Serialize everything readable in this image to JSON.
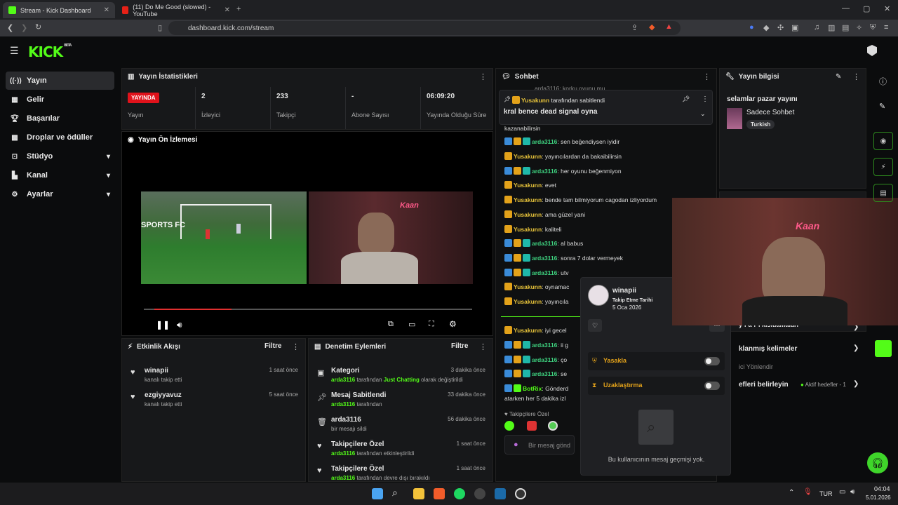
{
  "browser": {
    "tabs": [
      {
        "title": "Stream - Kick Dashboard"
      },
      {
        "title": "(11) Do Me Good (slowed) - YouTube"
      }
    ],
    "url": "dashboard.kick.com/stream"
  },
  "header": {
    "logo": "KICK",
    "beta": "BETA"
  },
  "sidebar": {
    "items": [
      {
        "label": "Yayın",
        "icon": "broadcast-icon"
      },
      {
        "label": "Gelir",
        "icon": "revenue-icon"
      },
      {
        "label": "Başarılar",
        "icon": "trophy-icon"
      },
      {
        "label": "Droplar ve ödüller",
        "icon": "gift-icon"
      },
      {
        "label": "Stüdyo",
        "icon": "studio-icon"
      },
      {
        "label": "Kanal",
        "icon": "channel-icon"
      },
      {
        "label": "Ayarlar",
        "icon": "gear-icon"
      }
    ]
  },
  "stats": {
    "title": "Yayın İstatistikleri",
    "live_badge": "YAYINDA",
    "live_label": "Yayın",
    "viewers_value": "2",
    "viewers_label": "İzleyici",
    "followers_value": "233",
    "followers_label": "Takipçi",
    "subs_value": "-",
    "subs_label": "Abone Sayısı",
    "uptime_value": "06:09:20",
    "uptime_label": "Yayında Olduğu Süre"
  },
  "preview": {
    "title": "Yayın Ön İzlemesi",
    "overlay_text": "SPORTS FC",
    "neon_text": "Kaan"
  },
  "activity": {
    "title": "Etkinlik Akışı",
    "filter": "Filtre",
    "items": [
      {
        "name": "winapii",
        "sub": "kanalı takip etti",
        "time": "1 saat önce"
      },
      {
        "name": "ezgiyyavuz",
        "sub": "kanalı takip etti",
        "time": "5 saat önce"
      }
    ]
  },
  "moderation": {
    "title": "Denetim Eylemleri",
    "filter": "Filtre",
    "items": [
      {
        "name": "Kategori",
        "sub_user": "arda3116",
        "sub_mid": " tarafından ",
        "sub_hl": "Just Chatting",
        "sub_end": " olarak değiştirildi",
        "time": "3 dakika önce"
      },
      {
        "name": "Mesaj Sabitlendi",
        "sub_user": "arda3116",
        "sub_mid": " tarafından",
        "time": "33 dakika önce"
      },
      {
        "name": "arda3116",
        "sub_plain": "bir mesajı sildi",
        "time": "56 dakika önce"
      },
      {
        "name": "Takipçilere Özel",
        "sub_user": "arda3116",
        "sub_mid": " tarafından etkinleştirildi",
        "time": "1 saat önce"
      },
      {
        "name": "Takipçilere Özel",
        "sub_user": "arda3116",
        "sub_mid": " tarafından devre dışı bırakıldı",
        "time": "1 saat önce"
      }
    ]
  },
  "chat": {
    "title": "Sohbet",
    "pinned_by": "Yusakunn",
    "pinned_label": " tarafından sabitlendi",
    "pinned_text": "kral bence dead signal oyna",
    "top_line": "arda3116: korku oyunu mu",
    "wrap_line": "kazanabilirsin",
    "messages": [
      {
        "user": "arda3116",
        "text": ": sen beğendiysen iyidir"
      },
      {
        "user": "Yusakunn",
        "text": ": yayıncılardan da bakaibilirsin"
      },
      {
        "user": "arda3116",
        "text": ": her oyunu beğenmiyon"
      },
      {
        "user": "Yusakunn",
        "text": ": evet"
      },
      {
        "user": "Yusakunn",
        "text": ": bende tam bilmiyorum cagodan izliyordum"
      },
      {
        "user": "Yusakunn",
        "text": ": ama güzel yani"
      },
      {
        "user": "Yusakunn",
        "text": ": kaliteli"
      },
      {
        "user": "arda3116",
        "text": ": al babus"
      },
      {
        "user": "arda3116",
        "text": ": sonra 7 dolar vermeyek"
      },
      {
        "user": "arda3116",
        "text": ": utv"
      },
      {
        "user": "Yusakunn",
        "text": ": oynamac"
      },
      {
        "user": "Yusakunn",
        "text": ": yayıncıla"
      },
      {
        "user": "Yusakunn",
        "text": ": iyi gecel"
      },
      {
        "user": "arda3116",
        "text": ": ii g"
      },
      {
        "user": "arda3116",
        "text": ": ço"
      },
      {
        "user": "arda3116",
        "text": ": se"
      },
      {
        "user": "BotRix",
        "text": ": Gönderd"
      }
    ],
    "bot_wrap": "atarken her 5 dakika izl",
    "followers_only": "Takipçilere Özel",
    "input_placeholder": "Bir mesaj gönd"
  },
  "stream_info": {
    "title": "Yayın bilgisi",
    "stream_title": "selamlar pazar yayını",
    "category": "Sadece Sohbet",
    "tag": "Turkish"
  },
  "user_card": {
    "name": "winapii",
    "follow_label": "Takip Etme Tarihi",
    "follow_date": "5 Oca 2026",
    "ban_label": "Yasakla",
    "timeout_label": "Uzaklaştırma",
    "empty_history": "Bu kullanıcının mesaj geçmişi yok."
  },
  "mod_tools": {
    "banned_words": "klanmış kelimeler",
    "rules": "ici Yönlendir",
    "goals": "efleri belirleyin",
    "goals_status": "Aktif hedefler - 1",
    "partial": "y·ı·a·r·ı kısıtlamaları"
  },
  "taskbar": {
    "lang": "TUR",
    "time": "04:04",
    "date": "5.01.2026"
  },
  "colors": {
    "brand": "#53fc18",
    "live": "#e0121b"
  }
}
